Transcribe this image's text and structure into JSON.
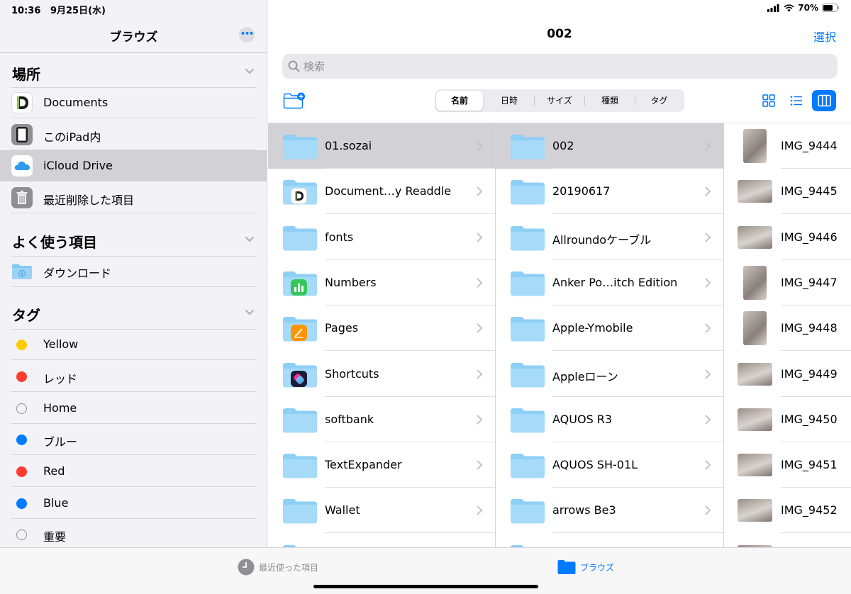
{
  "status": {
    "time": "10:36",
    "date": "9月25日(水)",
    "battery": "70%"
  },
  "sidebar": {
    "title": "ブラウズ",
    "more_label": "•••",
    "sections": {
      "locations": "場所",
      "favorites": "よく使う項目",
      "tags": "タグ"
    },
    "locations": [
      {
        "label": "Documents",
        "icon": "documents-app-icon"
      },
      {
        "label": "このiPad内",
        "icon": "ipad-icon"
      },
      {
        "label": "iCloud Drive",
        "icon": "icloud-icon",
        "active": true
      },
      {
        "label": "最近削除した項目",
        "icon": "trash-icon"
      }
    ],
    "favorites": [
      {
        "label": "ダウンロード",
        "icon": "downloads-folder-icon"
      }
    ],
    "tags": [
      {
        "label": "Yellow",
        "color": "#ffcc00"
      },
      {
        "label": "レッド",
        "color": "#ff3b30"
      },
      {
        "label": "Home",
        "color": ""
      },
      {
        "label": "ブルー",
        "color": "#007aff"
      },
      {
        "label": "Red",
        "color": "#ff3b30"
      },
      {
        "label": "Blue",
        "color": "#007aff"
      },
      {
        "label": "重要",
        "color": ""
      }
    ]
  },
  "main": {
    "title": "002",
    "select_label": "選択",
    "search_placeholder": "検索",
    "sort": [
      "名前",
      "日時",
      "サイズ",
      "種類",
      "タグ"
    ],
    "sort_selected": "名前",
    "view_modes": [
      "icons",
      "list",
      "columns"
    ],
    "view_selected": "columns",
    "column1": [
      {
        "name": "01.sozai",
        "badge": "",
        "selected": true
      },
      {
        "name": "Document…y Readdle",
        "badge": "documents"
      },
      {
        "name": "fonts",
        "badge": ""
      },
      {
        "name": "Numbers",
        "badge": "numbers"
      },
      {
        "name": "Pages",
        "badge": "pages"
      },
      {
        "name": "Shortcuts",
        "badge": "shortcuts"
      },
      {
        "name": "softbank",
        "badge": ""
      },
      {
        "name": "TextExpander",
        "badge": ""
      },
      {
        "name": "Wallet",
        "badge": ""
      }
    ],
    "column2": [
      {
        "name": "002",
        "selected": true
      },
      {
        "name": "20190617"
      },
      {
        "name": "Allroundoケーブル"
      },
      {
        "name": "Anker Po…itch Edition"
      },
      {
        "name": "Apple-Ymobile"
      },
      {
        "name": "Appleローン"
      },
      {
        "name": "AQUOS R3"
      },
      {
        "name": "AQUOS SH-01L"
      },
      {
        "name": "arrows Be3"
      }
    ],
    "column3": [
      {
        "name": "IMG_9444",
        "orientation": "portrait"
      },
      {
        "name": "IMG_9445",
        "orientation": "landscape"
      },
      {
        "name": "IMG_9446",
        "orientation": "landscape"
      },
      {
        "name": "IMG_9447",
        "orientation": "portrait"
      },
      {
        "name": "IMG_9448",
        "orientation": "portrait"
      },
      {
        "name": "IMG_9449",
        "orientation": "landscape"
      },
      {
        "name": "IMG_9450",
        "orientation": "landscape"
      },
      {
        "name": "IMG_9451",
        "orientation": "landscape"
      },
      {
        "name": "IMG_9452",
        "orientation": "landscape"
      }
    ]
  },
  "tabbar": {
    "recents": "最近使った項目",
    "browse": "ブラウズ"
  }
}
